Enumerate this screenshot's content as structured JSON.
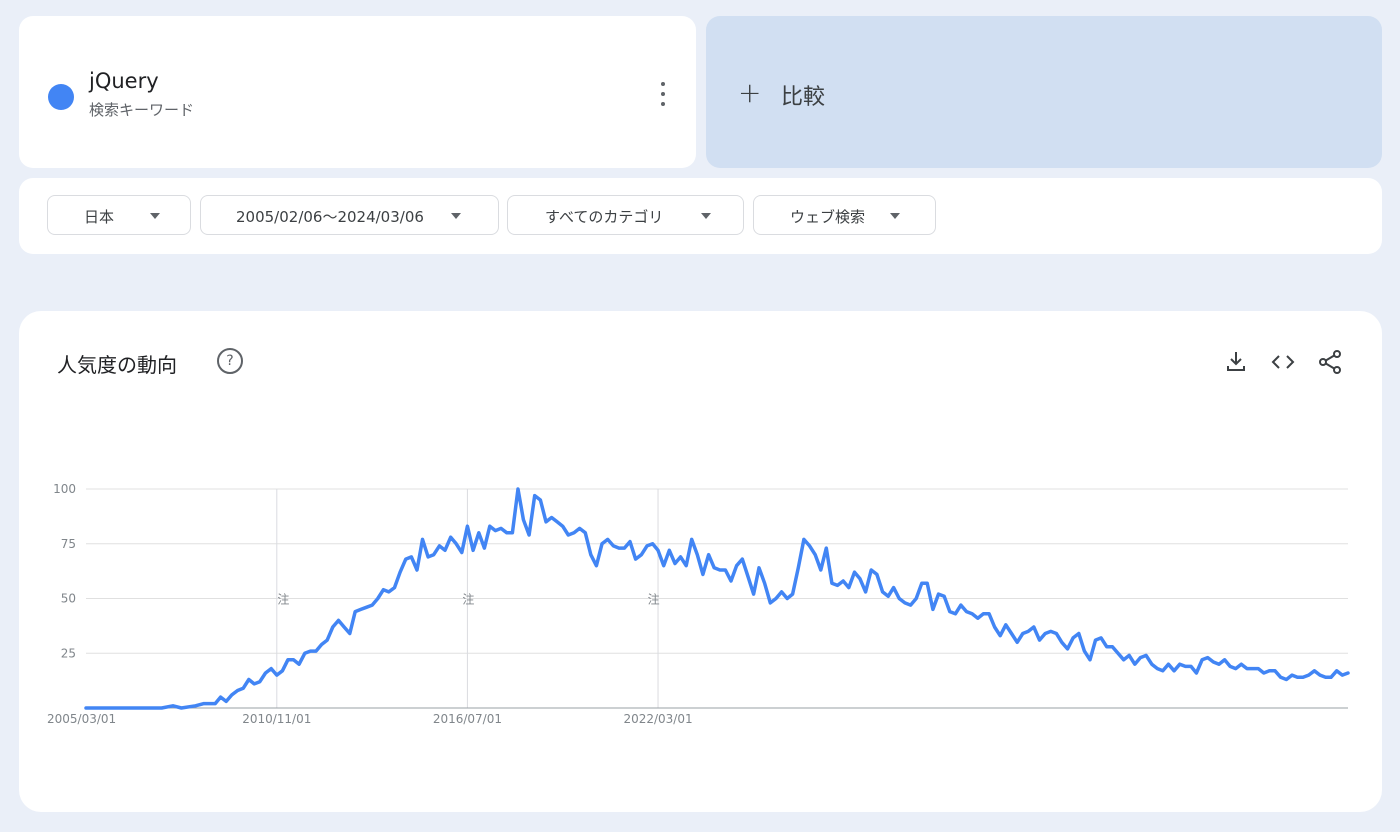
{
  "term": {
    "name": "jQuery",
    "type": "検索キーワード",
    "color": "#4285f4",
    "menu_icon": "more-vert-icon"
  },
  "compare": {
    "plus_icon": "+",
    "label": "比較"
  },
  "filters": {
    "region": "日本",
    "date_range": "2005/02/06～2024/03/06",
    "category": "すべてのカテゴリ",
    "search_type": "ウェブ検索"
  },
  "chart_card": {
    "title": "人気度の動向",
    "help_icon": "?",
    "actions": [
      "download-icon",
      "embed-icon",
      "share-icon"
    ]
  },
  "chart_data": {
    "type": "line",
    "title": "",
    "xlabel": "",
    "ylabel": "",
    "ylim": [
      0,
      100
    ],
    "yticks": [
      25,
      50,
      75,
      100
    ],
    "x_tick_labels": [
      "2005/03/01",
      "2010/11/01",
      "2016/07/01",
      "2022/03/01"
    ],
    "note_label": "注",
    "note_dates": [
      "2011/01",
      "2016/07",
      "2022/01"
    ],
    "grid": true,
    "series": [
      {
        "color": "#4285f4",
        "points": [
          [
            "2005/03",
            0
          ],
          [
            "2006/06",
            0
          ],
          [
            "2007/06",
            0
          ],
          [
            "2007/10",
            1
          ],
          [
            "2008/01",
            0
          ],
          [
            "2008/06",
            1
          ],
          [
            "2008/09",
            2
          ],
          [
            "2009/01",
            2
          ],
          [
            "2009/03",
            5
          ],
          [
            "2009/05",
            3
          ],
          [
            "2009/07",
            6
          ],
          [
            "2009/09",
            8
          ],
          [
            "2009/11",
            9
          ],
          [
            "2010/01",
            13
          ],
          [
            "2010/03",
            11
          ],
          [
            "2010/05",
            12
          ],
          [
            "2010/07",
            16
          ],
          [
            "2010/09",
            18
          ],
          [
            "2010/11",
            15
          ],
          [
            "2011/01",
            17
          ],
          [
            "2011/03",
            22
          ],
          [
            "2011/05",
            22
          ],
          [
            "2011/07",
            20
          ],
          [
            "2011/09",
            25
          ],
          [
            "2011/11",
            26
          ],
          [
            "2012/01",
            26
          ],
          [
            "2012/03",
            29
          ],
          [
            "2012/05",
            31
          ],
          [
            "2012/07",
            37
          ],
          [
            "2012/09",
            40
          ],
          [
            "2012/11",
            37
          ],
          [
            "2013/01",
            34
          ],
          [
            "2013/03",
            44
          ],
          [
            "2013/05",
            45
          ],
          [
            "2013/07",
            46
          ],
          [
            "2013/09",
            47
          ],
          [
            "2013/11",
            50
          ],
          [
            "2014/01",
            54
          ],
          [
            "2014/03",
            53
          ],
          [
            "2014/05",
            55
          ],
          [
            "2014/07",
            62
          ],
          [
            "2014/09",
            68
          ],
          [
            "2014/11",
            69
          ],
          [
            "2015/01",
            63
          ],
          [
            "2015/03",
            77
          ],
          [
            "2015/05",
            69
          ],
          [
            "2015/07",
            70
          ],
          [
            "2015/09",
            74
          ],
          [
            "2015/11",
            72
          ],
          [
            "2016/01",
            78
          ],
          [
            "2016/03",
            75
          ],
          [
            "2016/05",
            71
          ],
          [
            "2016/07",
            83
          ],
          [
            "2016/09",
            72
          ],
          [
            "2016/11",
            80
          ],
          [
            "2017/01",
            73
          ],
          [
            "2017/03",
            83
          ],
          [
            "2017/05",
            81
          ],
          [
            "2017/07",
            82
          ],
          [
            "2017/09",
            80
          ],
          [
            "2017/11",
            80
          ],
          [
            "2018/01",
            100
          ],
          [
            "2018/03",
            86
          ],
          [
            "2018/05",
            79
          ],
          [
            "2018/07",
            97
          ],
          [
            "2018/09",
            95
          ],
          [
            "2018/11",
            85
          ],
          [
            "2019/01",
            87
          ],
          [
            "2019/03",
            85
          ],
          [
            "2019/05",
            83
          ],
          [
            "2019/07",
            79
          ],
          [
            "2019/09",
            80
          ],
          [
            "2019/11",
            82
          ],
          [
            "2020/01",
            80
          ],
          [
            "2020/03",
            70
          ],
          [
            "2020/05",
            65
          ],
          [
            "2020/07",
            75
          ],
          [
            "2020/09",
            77
          ],
          [
            "2020/11",
            74
          ],
          [
            "2021/01",
            73
          ],
          [
            "2021/03",
            73
          ],
          [
            "2021/05",
            76
          ],
          [
            "2021/07",
            68
          ],
          [
            "2021/09",
            70
          ],
          [
            "2021/11",
            74
          ],
          [
            "2022/01",
            75
          ],
          [
            "2022/03",
            72
          ],
          [
            "2022/05",
            65
          ],
          [
            "2022/07",
            72
          ],
          [
            "2022/09",
            66
          ],
          [
            "2022/11",
            69
          ],
          [
            "2023/01",
            65
          ],
          [
            "2023/03",
            77
          ],
          [
            "2023/05",
            70
          ],
          [
            "2023/07",
            61
          ],
          [
            "2023/09",
            70
          ],
          [
            "2023/11",
            64
          ],
          [
            "2024/01",
            63
          ],
          [
            "2024/03",
            63
          ],
          [
            "2024/05",
            58
          ],
          [
            "2024/07",
            65
          ],
          [
            "2024/09",
            68
          ],
          [
            "2024/11",
            60
          ],
          [
            "2025/01",
            52
          ],
          [
            "2025/03",
            64
          ],
          [
            "2025/05",
            57
          ],
          [
            "2025/07",
            48
          ],
          [
            "2025/09",
            50
          ],
          [
            "2025/11",
            53
          ],
          [
            "2026/01",
            50
          ],
          [
            "2026/03",
            52
          ],
          [
            "2026/05",
            64
          ],
          [
            "2026/07",
            77
          ],
          [
            "2026/09",
            74
          ],
          [
            "2026/11",
            70
          ],
          [
            "2027/01",
            63
          ],
          [
            "2027/03",
            73
          ],
          [
            "2027/05",
            57
          ],
          [
            "2027/07",
            56
          ],
          [
            "2027/09",
            58
          ],
          [
            "2027/11",
            55
          ],
          [
            "2028/01",
            62
          ],
          [
            "2028/03",
            59
          ],
          [
            "2028/05",
            53
          ],
          [
            "2028/07",
            63
          ],
          [
            "2028/09",
            61
          ],
          [
            "2028/11",
            53
          ],
          [
            "2029/01",
            51
          ],
          [
            "2029/03",
            55
          ],
          [
            "2029/05",
            50
          ],
          [
            "2029/07",
            48
          ],
          [
            "2029/09",
            47
          ],
          [
            "2029/11",
            50
          ],
          [
            "2030/01",
            57
          ],
          [
            "2030/03",
            57
          ],
          [
            "2030/05",
            45
          ],
          [
            "2030/07",
            52
          ],
          [
            "2030/09",
            51
          ],
          [
            "2030/11",
            44
          ],
          [
            "2031/01",
            43
          ],
          [
            "2031/03",
            47
          ],
          [
            "2031/05",
            44
          ],
          [
            "2031/07",
            43
          ],
          [
            "2031/09",
            41
          ],
          [
            "2031/11",
            43
          ],
          [
            "2032/01",
            43
          ],
          [
            "2032/03",
            37
          ],
          [
            "2032/05",
            33
          ],
          [
            "2032/07",
            38
          ],
          [
            "2032/09",
            34
          ],
          [
            "2032/11",
            30
          ],
          [
            "2033/01",
            34
          ],
          [
            "2033/03",
            35
          ],
          [
            "2033/05",
            37
          ],
          [
            "2033/07",
            31
          ],
          [
            "2033/09",
            34
          ],
          [
            "2033/11",
            35
          ],
          [
            "2034/01",
            34
          ],
          [
            "2034/03",
            30
          ],
          [
            "2034/05",
            27
          ],
          [
            "2034/07",
            32
          ],
          [
            "2034/09",
            34
          ],
          [
            "2034/11",
            26
          ],
          [
            "2035/01",
            22
          ],
          [
            "2035/03",
            31
          ],
          [
            "2035/05",
            32
          ],
          [
            "2035/07",
            28
          ],
          [
            "2035/09",
            28
          ],
          [
            "2035/11",
            25
          ],
          [
            "2036/01",
            22
          ],
          [
            "2036/03",
            24
          ],
          [
            "2036/05",
            20
          ],
          [
            "2036/07",
            23
          ],
          [
            "2036/09",
            24
          ],
          [
            "2036/11",
            20
          ],
          [
            "2037/01",
            18
          ],
          [
            "2037/03",
            17
          ],
          [
            "2037/05",
            20
          ],
          [
            "2037/07",
            17
          ],
          [
            "2037/09",
            20
          ],
          [
            "2037/11",
            19
          ],
          [
            "2038/01",
            19
          ],
          [
            "2038/03",
            16
          ],
          [
            "2038/05",
            22
          ],
          [
            "2038/07",
            23
          ],
          [
            "2038/09",
            21
          ],
          [
            "2038/11",
            20
          ],
          [
            "2039/01",
            22
          ],
          [
            "2039/03",
            19
          ],
          [
            "2039/05",
            18
          ],
          [
            "2039/07",
            20
          ],
          [
            "2039/09",
            18
          ],
          [
            "2039/11",
            18
          ],
          [
            "2040/01",
            18
          ],
          [
            "2040/03",
            16
          ],
          [
            "2040/05",
            17
          ],
          [
            "2040/07",
            17
          ],
          [
            "2040/09",
            14
          ],
          [
            "2040/11",
            13
          ],
          [
            "2041/01",
            15
          ],
          [
            "2041/03",
            14
          ],
          [
            "2041/05",
            14
          ],
          [
            "2041/07",
            15
          ],
          [
            "2041/09",
            17
          ],
          [
            "2041/11",
            15
          ],
          [
            "2042/01",
            14
          ],
          [
            "2042/03",
            14
          ],
          [
            "2042/05",
            17
          ],
          [
            "2042/07",
            15
          ],
          [
            "2042/09",
            16
          ]
        ]
      }
    ]
  }
}
